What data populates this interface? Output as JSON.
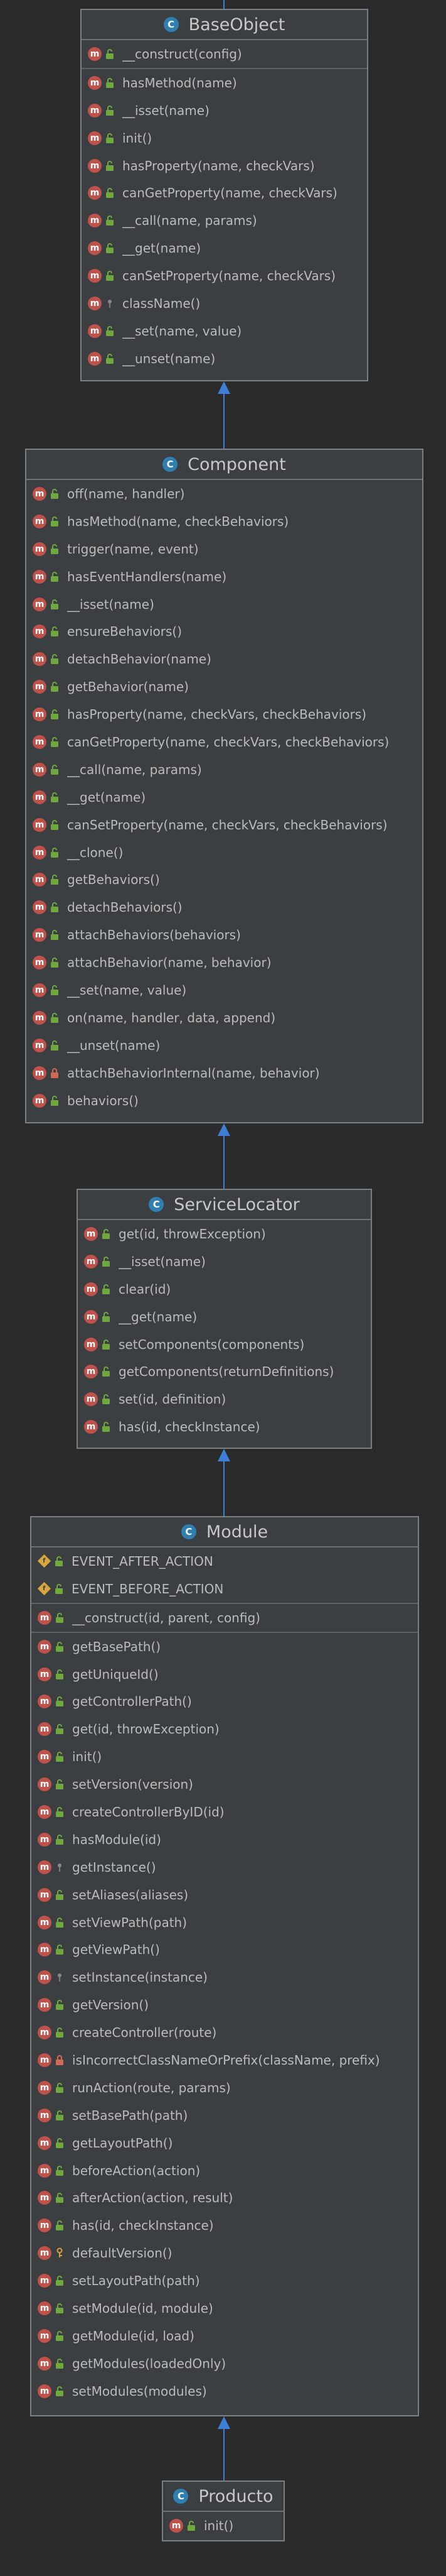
{
  "classes": [
    {
      "name": "BaseObject",
      "badge": "C",
      "fields": [],
      "methods": [
        {
          "vis": "public",
          "label": "__construct(config)"
        },
        {
          "vis": "public",
          "label": "hasMethod(name)",
          "sep": true
        },
        {
          "vis": "public",
          "label": "__isset(name)"
        },
        {
          "vis": "public",
          "label": "init()"
        },
        {
          "vis": "public",
          "label": "hasProperty(name, checkVars)"
        },
        {
          "vis": "public",
          "label": "canGetProperty(name, checkVars)"
        },
        {
          "vis": "public",
          "label": "__call(name, params)"
        },
        {
          "vis": "public",
          "label": "__get(name)"
        },
        {
          "vis": "public",
          "label": "canSetProperty(name, checkVars)"
        },
        {
          "vis": "static",
          "label": "className()"
        },
        {
          "vis": "public",
          "label": "__set(name, value)"
        },
        {
          "vis": "public",
          "label": "__unset(name)"
        }
      ]
    },
    {
      "name": "Component",
      "badge": "C",
      "fields": [],
      "methods": [
        {
          "vis": "public",
          "label": "off(name, handler)"
        },
        {
          "vis": "public",
          "label": "hasMethod(name, checkBehaviors)"
        },
        {
          "vis": "public",
          "label": "trigger(name, event)"
        },
        {
          "vis": "public",
          "label": "hasEventHandlers(name)"
        },
        {
          "vis": "public",
          "label": "__isset(name)"
        },
        {
          "vis": "public",
          "label": "ensureBehaviors()"
        },
        {
          "vis": "public",
          "label": "detachBehavior(name)"
        },
        {
          "vis": "public",
          "label": "getBehavior(name)"
        },
        {
          "vis": "public",
          "label": "hasProperty(name, checkVars, checkBehaviors)"
        },
        {
          "vis": "public",
          "label": "canGetProperty(name, checkVars, checkBehaviors)"
        },
        {
          "vis": "public",
          "label": "__call(name, params)"
        },
        {
          "vis": "public",
          "label": "__get(name)"
        },
        {
          "vis": "public",
          "label": "canSetProperty(name, checkVars, checkBehaviors)"
        },
        {
          "vis": "public",
          "label": "__clone()"
        },
        {
          "vis": "public",
          "label": "getBehaviors()"
        },
        {
          "vis": "public",
          "label": "detachBehaviors()"
        },
        {
          "vis": "public",
          "label": "attachBehaviors(behaviors)"
        },
        {
          "vis": "public",
          "label": "attachBehavior(name, behavior)"
        },
        {
          "vis": "public",
          "label": "__set(name, value)"
        },
        {
          "vis": "public",
          "label": "on(name, handler, data, append)"
        },
        {
          "vis": "public",
          "label": "__unset(name)"
        },
        {
          "vis": "private",
          "label": "attachBehaviorInternal(name, behavior)"
        },
        {
          "vis": "public",
          "label": "behaviors()"
        }
      ]
    },
    {
      "name": "ServiceLocator",
      "badge": "C",
      "fields": [],
      "methods": [
        {
          "vis": "public",
          "label": "get(id, throwException)"
        },
        {
          "vis": "public",
          "label": "__isset(name)"
        },
        {
          "vis": "public",
          "label": "clear(id)"
        },
        {
          "vis": "public",
          "label": "__get(name)"
        },
        {
          "vis": "public",
          "label": "setComponents(components)"
        },
        {
          "vis": "public",
          "label": "getComponents(returnDefinitions)"
        },
        {
          "vis": "public",
          "label": "set(id, definition)"
        },
        {
          "vis": "public",
          "label": "has(id, checkInstance)"
        }
      ]
    },
    {
      "name": "Module",
      "badge": "C",
      "fields": [
        {
          "vis": "public",
          "label": "EVENT_AFTER_ACTION"
        },
        {
          "vis": "public",
          "label": "EVENT_BEFORE_ACTION"
        }
      ],
      "methods": [
        {
          "vis": "public",
          "label": "__construct(id, parent, config)"
        },
        {
          "vis": "public",
          "label": "getBasePath()",
          "sep": true
        },
        {
          "vis": "public",
          "label": "getUniqueId()"
        },
        {
          "vis": "public",
          "label": "getControllerPath()"
        },
        {
          "vis": "public",
          "label": "get(id, throwException)"
        },
        {
          "vis": "public",
          "label": "init()"
        },
        {
          "vis": "public",
          "label": "setVersion(version)"
        },
        {
          "vis": "public",
          "label": "createControllerByID(id)"
        },
        {
          "vis": "public",
          "label": "hasModule(id)"
        },
        {
          "vis": "static",
          "label": "getInstance()"
        },
        {
          "vis": "public",
          "label": "setAliases(aliases)"
        },
        {
          "vis": "public",
          "label": "setViewPath(path)"
        },
        {
          "vis": "public",
          "label": "getViewPath()"
        },
        {
          "vis": "static",
          "label": "setInstance(instance)"
        },
        {
          "vis": "public",
          "label": "getVersion()"
        },
        {
          "vis": "public",
          "label": "createController(route)"
        },
        {
          "vis": "private",
          "label": "isIncorrectClassNameOrPrefix(className, prefix)"
        },
        {
          "vis": "public",
          "label": "runAction(route, params)"
        },
        {
          "vis": "public",
          "label": "setBasePath(path)"
        },
        {
          "vis": "public",
          "label": "getLayoutPath()"
        },
        {
          "vis": "public",
          "label": "beforeAction(action)"
        },
        {
          "vis": "public",
          "label": "afterAction(action, result)"
        },
        {
          "vis": "public",
          "label": "has(id, checkInstance)"
        },
        {
          "vis": "protected",
          "label": "defaultVersion()"
        },
        {
          "vis": "public",
          "label": "setLayoutPath(path)"
        },
        {
          "vis": "public",
          "label": "setModule(id, module)"
        },
        {
          "vis": "public",
          "label": "getModule(id, load)"
        },
        {
          "vis": "public",
          "label": "getModules(loadedOnly)"
        },
        {
          "vis": "public",
          "label": "setModules(modules)"
        }
      ]
    },
    {
      "name": "Producto",
      "badge": "C",
      "fields": [],
      "methods": [
        {
          "vis": "public",
          "label": "init()"
        }
      ]
    }
  ],
  "icons": {
    "class_badge": "class-c-icon",
    "method": "method-m-icon",
    "field": "field-f-icon",
    "method_glyph": "m",
    "field_glyph": "f"
  },
  "colors": {
    "background": "#2b2b2b",
    "class_fill": "#3c3f41",
    "class_border": "#7a7f84",
    "class_badge": "#2f7fb1",
    "method_icon": "#c0524b",
    "field_icon": "#d8a63c",
    "public": "#6fa83c",
    "private": "#d06a55",
    "protected": "#d4a23a",
    "arrow": "#3d7fd6"
  }
}
